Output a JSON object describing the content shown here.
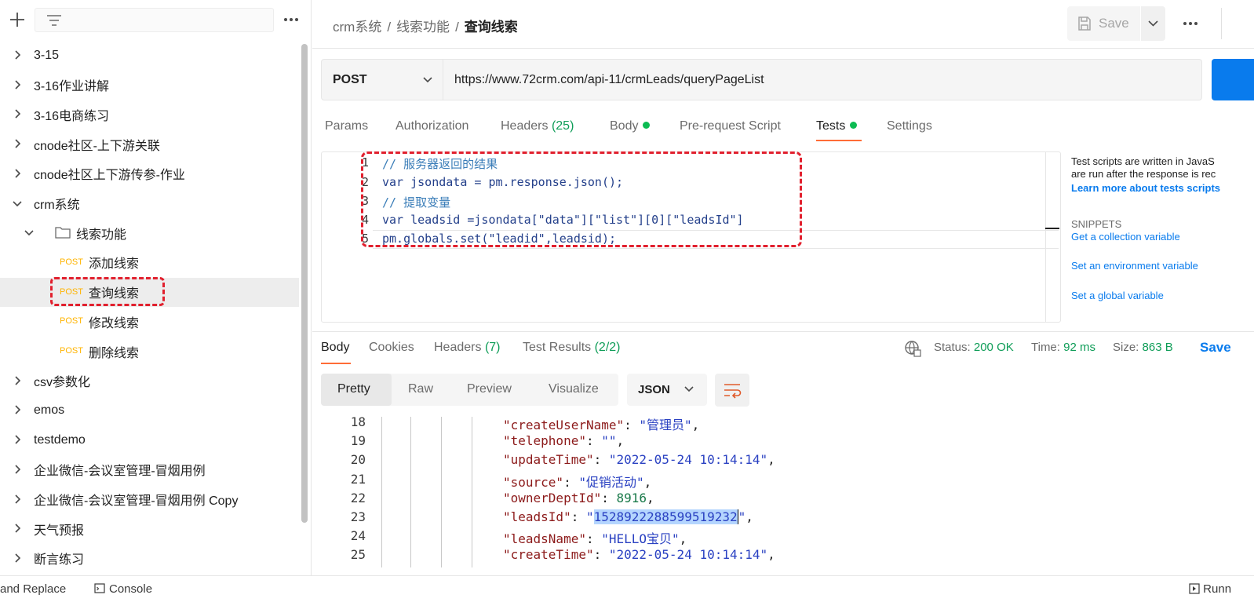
{
  "sidebar": {
    "items": [
      {
        "label": "3-15",
        "type": "collection",
        "expanded": false
      },
      {
        "label": "3-16作业讲解",
        "type": "collection",
        "expanded": false
      },
      {
        "label": "3-16电商练习",
        "type": "collection",
        "expanded": false
      },
      {
        "label": "cnode社区-上下游关联",
        "type": "collection",
        "expanded": false
      },
      {
        "label": "cnode社区上下游传参-作业",
        "type": "collection",
        "expanded": false
      },
      {
        "label": "crm系统",
        "type": "collection",
        "expanded": true
      },
      {
        "label": "线索功能",
        "type": "folder",
        "expanded": true
      },
      {
        "label": "添加线索",
        "type": "request",
        "method": "POST"
      },
      {
        "label": "查询线索",
        "type": "request",
        "method": "POST",
        "selected": true
      },
      {
        "label": "修改线索",
        "type": "request",
        "method": "POST"
      },
      {
        "label": "删除线索",
        "type": "request",
        "method": "POST"
      },
      {
        "label": "csv参数化",
        "type": "collection",
        "expanded": false
      },
      {
        "label": "emos",
        "type": "collection",
        "expanded": false
      },
      {
        "label": "testdemo",
        "type": "collection",
        "expanded": false
      },
      {
        "label": "企业微信-会议室管理-冒烟用例",
        "type": "collection",
        "expanded": false
      },
      {
        "label": "企业微信-会议室管理-冒烟用例 Copy",
        "type": "collection",
        "expanded": false
      },
      {
        "label": "天气预报",
        "type": "collection",
        "expanded": false
      },
      {
        "label": "断言练习",
        "type": "collection",
        "expanded": false
      }
    ]
  },
  "header": {
    "breadcrumb": [
      "crm系统",
      "线索功能",
      "查询线索"
    ],
    "save_label": "Save"
  },
  "request": {
    "method": "POST",
    "url": "https://www.72crm.com/api-11/crmLeads/queryPageList",
    "tabs": [
      {
        "label": "Params"
      },
      {
        "label": "Authorization"
      },
      {
        "label": "Headers",
        "count": "(25)"
      },
      {
        "label": "Body",
        "dot": true
      },
      {
        "label": "Pre-request Script"
      },
      {
        "label": "Tests",
        "dot": true,
        "active": true
      },
      {
        "label": "Settings"
      }
    ]
  },
  "editor": {
    "lines": [
      "1",
      "2",
      "3",
      "4",
      "5"
    ],
    "code": [
      "// 服务器返回的结果",
      "var jsondata = pm.response.json();",
      "// 提取变量",
      "var leadsid =jsondata[\"data\"][\"list\"][0][\"leadsId\"]",
      "pm.globals.set(\"leadid\",leadsid);"
    ]
  },
  "side_panel": {
    "desc_line1": "Test scripts are written in JavaS",
    "desc_line2": "are run after the response is rec",
    "learn_more": "Learn more about tests scripts",
    "snippets_title": "SNIPPETS",
    "snippets": [
      "Get a collection variable",
      "Set an environment variable",
      "Set a global variable"
    ]
  },
  "response": {
    "tabs": [
      {
        "label": "Body",
        "active": true
      },
      {
        "label": "Cookies"
      },
      {
        "label": "Headers",
        "count": "(7)"
      },
      {
        "label": "Test Results",
        "count": "(2/2)"
      }
    ],
    "status_label": "Status:",
    "status_value": "200 OK",
    "time_label": "Time:",
    "time_value": "92 ms",
    "size_label": "Size:",
    "size_value": "863 B",
    "save_label": "Save",
    "formats": [
      "Pretty",
      "Raw",
      "Preview",
      "Visualize"
    ],
    "format_type": "JSON",
    "lines": [
      {
        "n": "18",
        "key": "\"createUserName\"",
        "val": "\"管理员\"",
        "type": "s"
      },
      {
        "n": "19",
        "key": "\"telephone\"",
        "val": "\"\"",
        "type": "s"
      },
      {
        "n": "20",
        "key": "\"updateTime\"",
        "val": "\"2022-05-24 10:14:14\"",
        "type": "s"
      },
      {
        "n": "21",
        "key": "\"source\"",
        "val": "\"促销活动\"",
        "type": "s"
      },
      {
        "n": "22",
        "key": "\"ownerDeptId\"",
        "val": "8916",
        "type": "n"
      },
      {
        "n": "23",
        "key": "\"leadsId\"",
        "val": "1528922288599519232",
        "type": "sel"
      },
      {
        "n": "24",
        "key": "\"leadsName\"",
        "val": "\"HELLO宝贝\"",
        "type": "s"
      },
      {
        "n": "25",
        "key": "\"createTime\"",
        "val": "\"2022-05-24 10:14:14\"",
        "type": "s"
      }
    ]
  },
  "footer": {
    "find_label": "and Replace",
    "console_label": "Console",
    "runner_label": "Runn"
  },
  "colors": {
    "accent": "#ff6c37",
    "link": "#097bed",
    "method_post": "#ffb400",
    "success": "#0f9d58",
    "annotation": "#e1202e"
  }
}
